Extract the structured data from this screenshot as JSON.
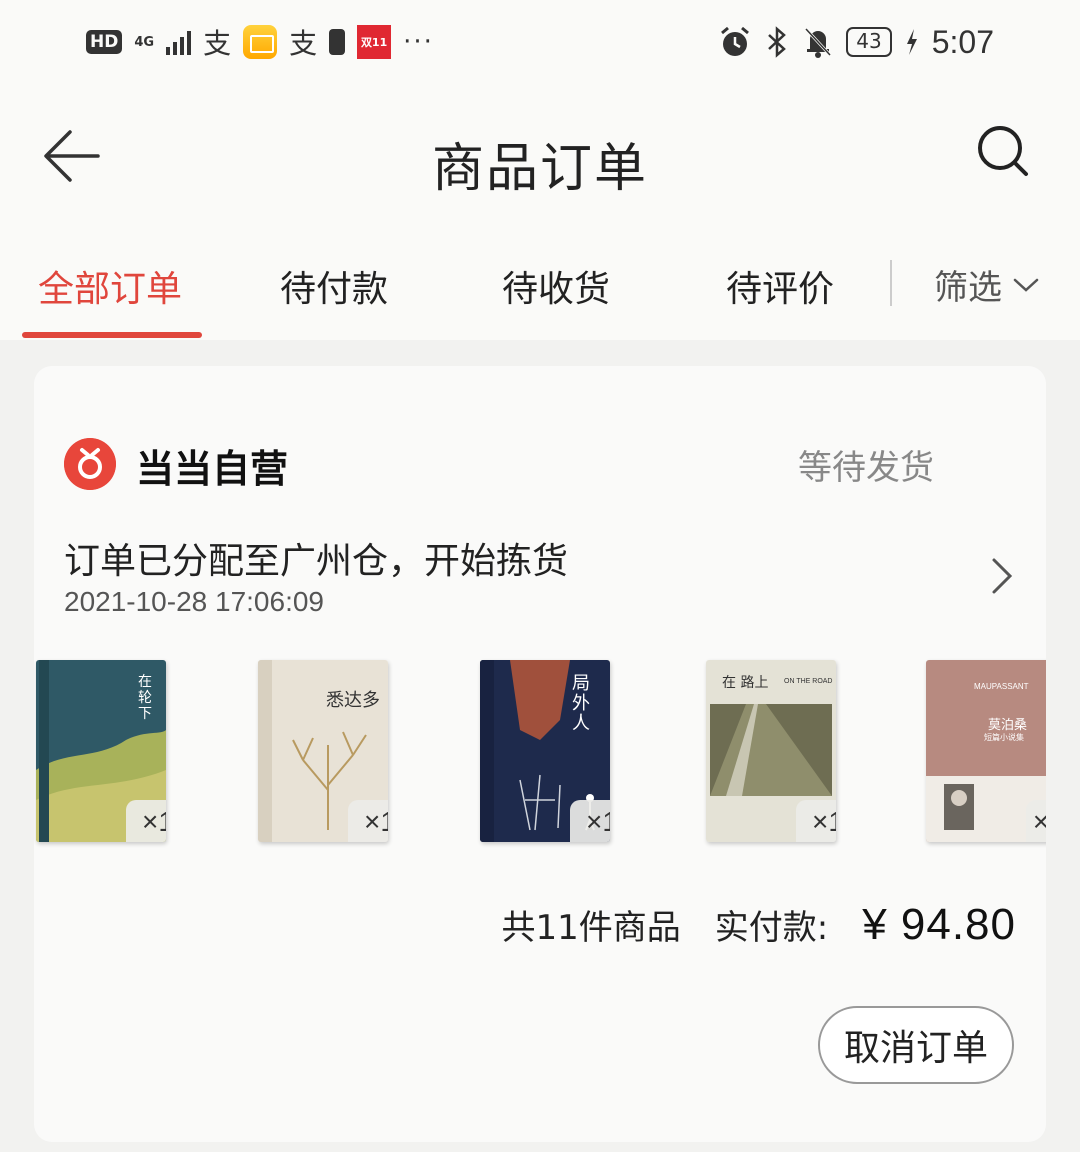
{
  "status_bar": {
    "hd": "HD",
    "network": "4G",
    "battery": "43",
    "time": "5:07",
    "alipay_glyph": "支",
    "shuang11": "双11",
    "more": "···"
  },
  "header": {
    "title": "商品订单",
    "back_icon": "back-arrow-icon",
    "search_icon": "search-icon"
  },
  "tabs": {
    "items": [
      {
        "label": "全部订单",
        "active": true
      },
      {
        "label": "待付款",
        "active": false
      },
      {
        "label": "待收货",
        "active": false
      },
      {
        "label": "待评价",
        "active": false
      }
    ],
    "filter_label": "筛选",
    "accent_color": "#e0463c"
  },
  "order": {
    "shop_name": "当当自营",
    "status": "等待发货",
    "shipping_message": "订单已分配至广州仓，开始拣货",
    "shipping_time": "2021-10-28 17:06:09",
    "books": [
      {
        "cover_title": "在轮下",
        "quantity": "×1",
        "color": "#2f5966"
      },
      {
        "cover_title": "悉达多",
        "quantity": "×1",
        "color": "#e8e2d6"
      },
      {
        "cover_title": "局外人",
        "quantity": "×1",
        "color": "#1e2a4c"
      },
      {
        "cover_title": "在 路上",
        "quantity": "×1",
        "color": "#d9d6c4"
      },
      {
        "cover_title": "莫泊桑",
        "quantity": "×",
        "color": "#b78a80"
      }
    ],
    "book_extra": {
      "road_en": "ON THE ROAD",
      "maupassant_en": "MAUPASSANT",
      "maupassant_sub": "短篇小说集"
    },
    "total_items": "共11件商品",
    "paid_label": "实付款:",
    "paid_amount": "¥ 94.80",
    "cancel_label": "取消订单"
  }
}
